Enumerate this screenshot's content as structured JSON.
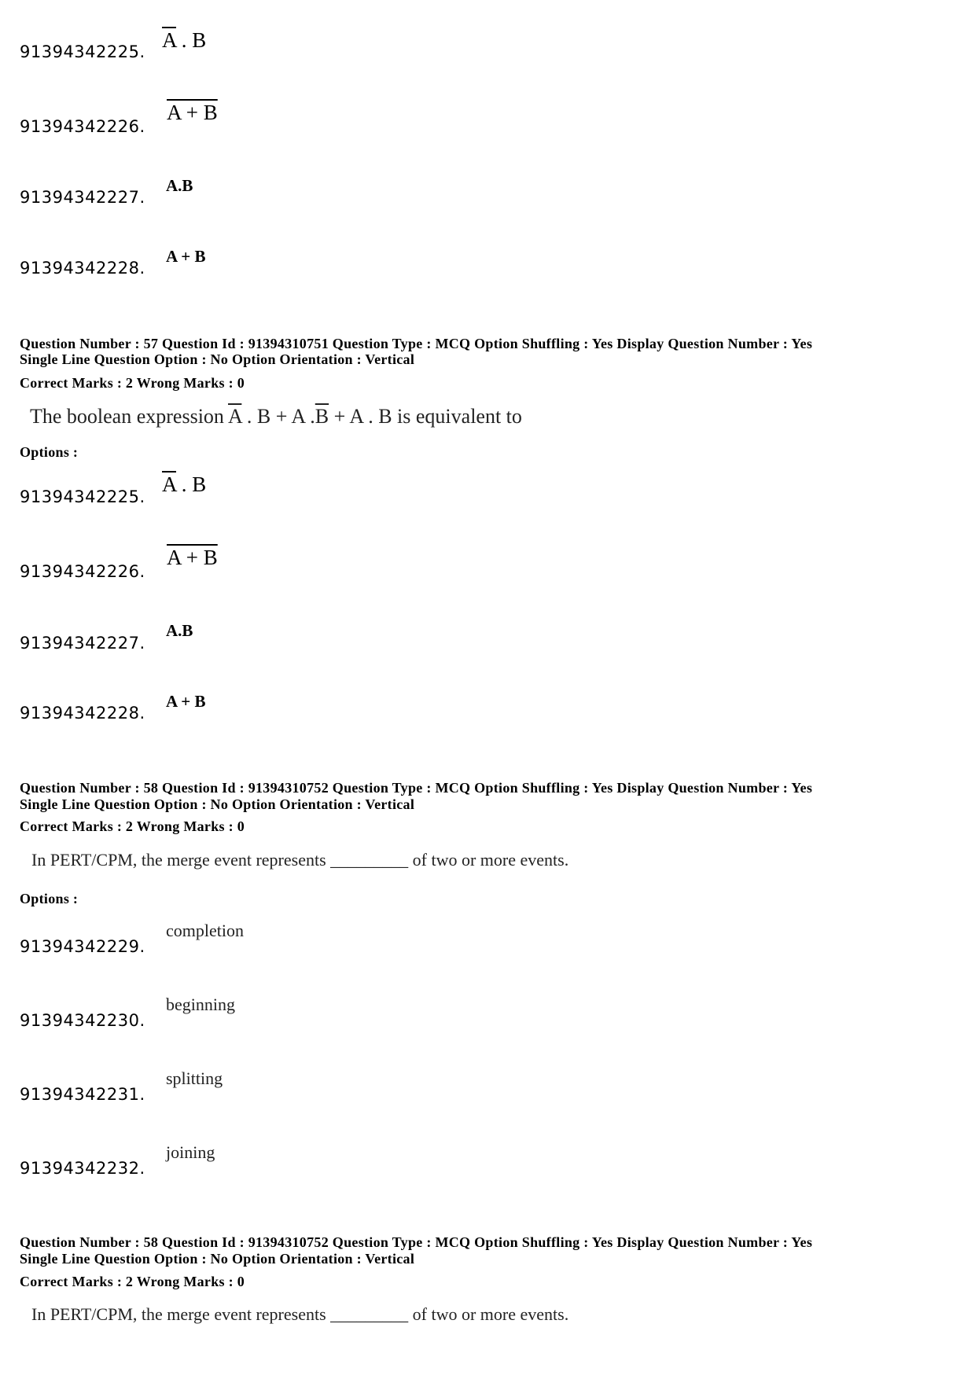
{
  "top_options": [
    {
      "id": "91394342225.",
      "expr": "A . B",
      "overline": "A"
    },
    {
      "id": "91394342226.",
      "expr": "A + B",
      "overline": "all"
    },
    {
      "id": "91394342227.",
      "expr": "A.B"
    },
    {
      "id": "91394342228.",
      "expr": "A + B"
    }
  ],
  "q57": {
    "meta1": "Question Number : 57  Question Id : 91394310751  Question Type : MCQ  Option Shuffling : Yes  Display Question Number : Yes",
    "meta2": "Single Line Question Option : No  Option Orientation : Vertical",
    "marks": "Correct Marks : 2  Wrong Marks : 0",
    "text_prefix": "The boolean expression",
    "text_a": "A",
    "text_mid1": " . B + A .",
    "text_b": "B",
    "text_mid2": "  + A . B",
    "text_suffix": " is equivalent to",
    "options_label": "Options :",
    "options": [
      {
        "id": "91394342225.",
        "expr": "A . B"
      },
      {
        "id": "91394342226.",
        "expr": "A + B"
      },
      {
        "id": "91394342227.",
        "expr": "A.B"
      },
      {
        "id": "91394342228.",
        "expr": "A + B"
      }
    ]
  },
  "q58": {
    "meta1": "Question Number : 58  Question Id : 91394310752  Question Type : MCQ  Option Shuffling : Yes  Display Question Number : Yes",
    "meta2": "Single Line Question Option : No  Option Orientation : Vertical",
    "marks": "Correct Marks : 2  Wrong Marks : 0",
    "text": "In PERT/CPM, the merge event represents _________ of two or more events.",
    "options_label": "Options :",
    "options": [
      {
        "id": "91394342229.",
        "text": "completion"
      },
      {
        "id": "91394342230.",
        "text": "beginning"
      },
      {
        "id": "91394342231.",
        "text": "splitting"
      },
      {
        "id": "91394342232.",
        "text": "joining"
      }
    ]
  },
  "q58b": {
    "meta1": "Question Number : 58  Question Id : 91394310752  Question Type : MCQ  Option Shuffling : Yes  Display Question Number : Yes",
    "meta2": "Single Line Question Option : No  Option Orientation : Vertical",
    "marks": "Correct Marks : 2  Wrong Marks : 0",
    "text": "In PERT/CPM, the merge event represents _________ of two or more events."
  }
}
